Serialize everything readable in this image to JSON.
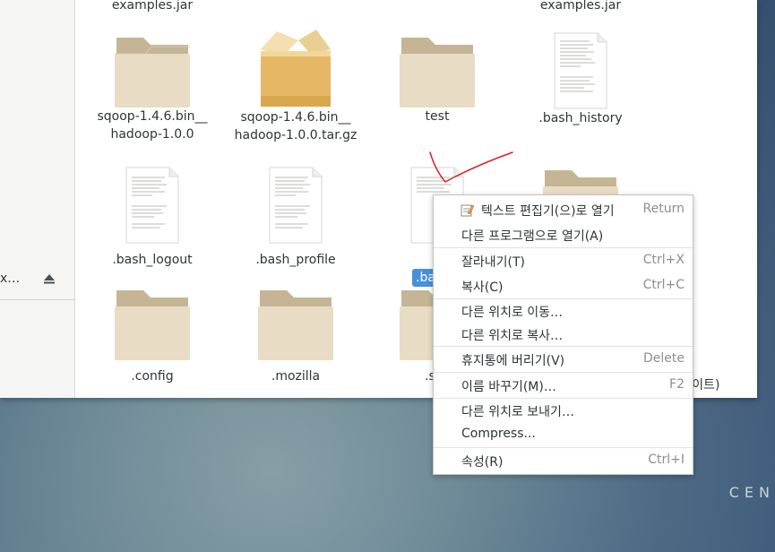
{
  "desktop": {
    "brand": "CEN"
  },
  "sidebar": {
    "row_label": "x…"
  },
  "files": [
    {
      "name": "examples.jar",
      "type": "top-label"
    },
    {
      "name": "examples.jar",
      "type": "top-label"
    },
    {
      "name": "sqoop-1.4.6.bin__\nhadoop-1.0.0",
      "type": "folder"
    },
    {
      "name": "sqoop-1.4.6.bin__\nhadoop-1.0.0.tar.gz",
      "type": "archive"
    },
    {
      "name": "test",
      "type": "folder"
    },
    {
      "name": ".bash_history",
      "type": "document"
    },
    {
      "name": ".bash_logout",
      "type": "document"
    },
    {
      "name": ".bash_profile",
      "type": "document"
    },
    {
      "name": ".ba",
      "type": "document",
      "selected": true
    },
    {
      "name": ".config",
      "type": "folder"
    },
    {
      "name": ".mozilla",
      "type": "folder"
    },
    {
      "name": ".s",
      "type": "folder"
    }
  ],
  "status": {
    "text": "1 바이트)"
  },
  "context_menu": {
    "items": [
      {
        "label": "텍스트 편집기(으)로 열기",
        "shortcut": "Return",
        "icon": "text-editor-icon"
      },
      {
        "label": "다른 프로그램으로 열기(A)",
        "shortcut": ""
      },
      {
        "label": "잘라내기(T)",
        "shortcut": "Ctrl+X"
      },
      {
        "label": "복사(C)",
        "shortcut": "Ctrl+C"
      },
      {
        "label": "다른 위치로 이동…",
        "shortcut": ""
      },
      {
        "label": "다른 위치로 복사…",
        "shortcut": ""
      },
      {
        "label": "휴지통에 버리기(V)",
        "shortcut": "Delete"
      },
      {
        "label": "이름 바꾸기(M)…",
        "shortcut": "F2"
      },
      {
        "label": "다른 위치로 보내기…",
        "shortcut": ""
      },
      {
        "label": "Compress...",
        "shortcut": ""
      },
      {
        "label": "속성(R)",
        "shortcut": "Ctrl+I"
      }
    ]
  },
  "colors": {
    "accent": "#4a90d9",
    "annotation": "#e02020",
    "folder": "#e8dcc4",
    "folder_tab": "#c9b99a"
  }
}
